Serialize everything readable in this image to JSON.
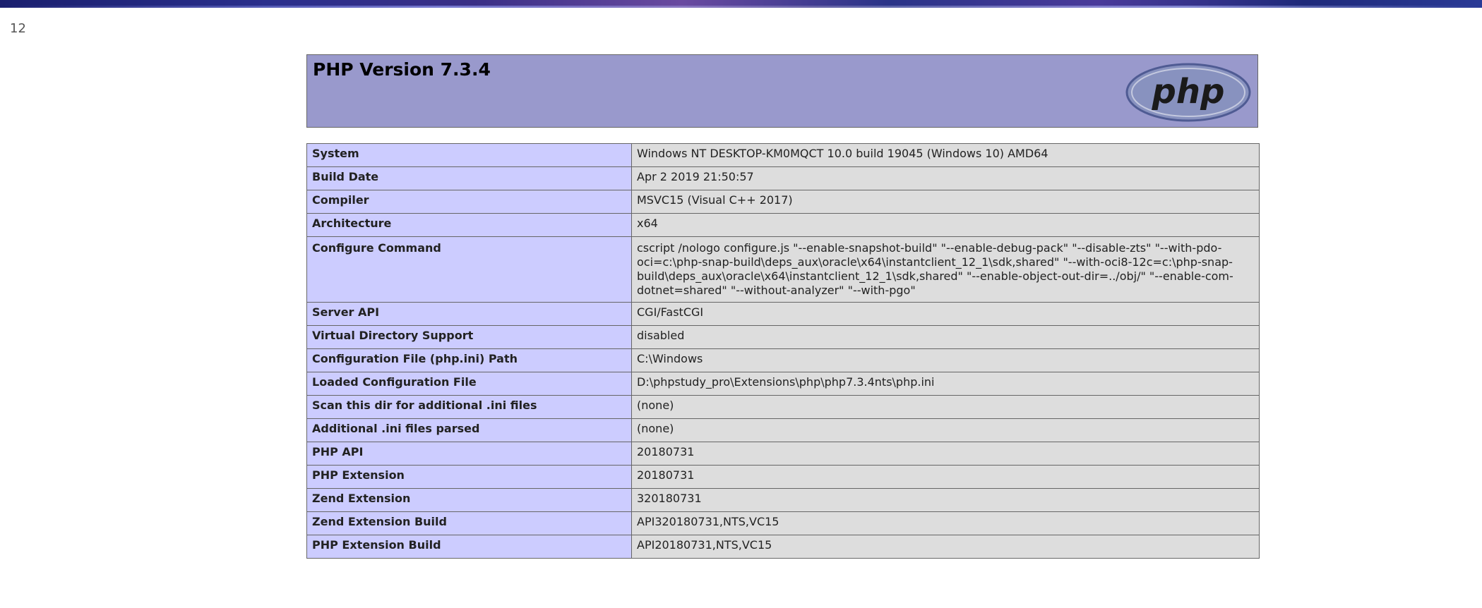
{
  "page": {
    "number": "12"
  },
  "header": {
    "title": "PHP Version 7.3.4",
    "logo_text": "php"
  },
  "colors": {
    "header_bg": "#9999cc",
    "key_cell_bg": "#ccccff",
    "value_cell_bg": "#dddddd",
    "border": "#666666",
    "logo_bg": "#8892bf"
  },
  "rows": [
    {
      "key": "System",
      "value": "Windows NT DESKTOP-KM0MQCT 10.0 build 19045 (Windows 10) AMD64"
    },
    {
      "key": "Build Date",
      "value": "Apr 2 2019 21:50:57"
    },
    {
      "key": "Compiler",
      "value": "MSVC15 (Visual C++ 2017)"
    },
    {
      "key": "Architecture",
      "value": "x64"
    },
    {
      "key": "Configure Command",
      "value": "cscript /nologo configure.js \"--enable-snapshot-build\" \"--enable-debug-pack\" \"--disable-zts\" \"--with-pdo-oci=c:\\php-snap-build\\deps_aux\\oracle\\x64\\instantclient_12_1\\sdk,shared\" \"--with-oci8-12c=c:\\php-snap-build\\deps_aux\\oracle\\x64\\instantclient_12_1\\sdk,shared\" \"--enable-object-out-dir=../obj/\" \"--enable-com-dotnet=shared\" \"--without-analyzer\" \"--with-pgo\""
    },
    {
      "key": "Server API",
      "value": "CGI/FastCGI"
    },
    {
      "key": "Virtual Directory Support",
      "value": "disabled"
    },
    {
      "key": "Configuration File (php.ini) Path",
      "value": "C:\\Windows"
    },
    {
      "key": "Loaded Configuration File",
      "value": "D:\\phpstudy_pro\\Extensions\\php\\php7.3.4nts\\php.ini"
    },
    {
      "key": "Scan this dir for additional .ini files",
      "value": "(none)"
    },
    {
      "key": "Additional .ini files parsed",
      "value": "(none)"
    },
    {
      "key": "PHP API",
      "value": "20180731"
    },
    {
      "key": "PHP Extension",
      "value": "20180731"
    },
    {
      "key": "Zend Extension",
      "value": "320180731"
    },
    {
      "key": "Zend Extension Build",
      "value": "API320180731,NTS,VC15"
    },
    {
      "key": "PHP Extension Build",
      "value": "API20180731,NTS,VC15"
    }
  ]
}
